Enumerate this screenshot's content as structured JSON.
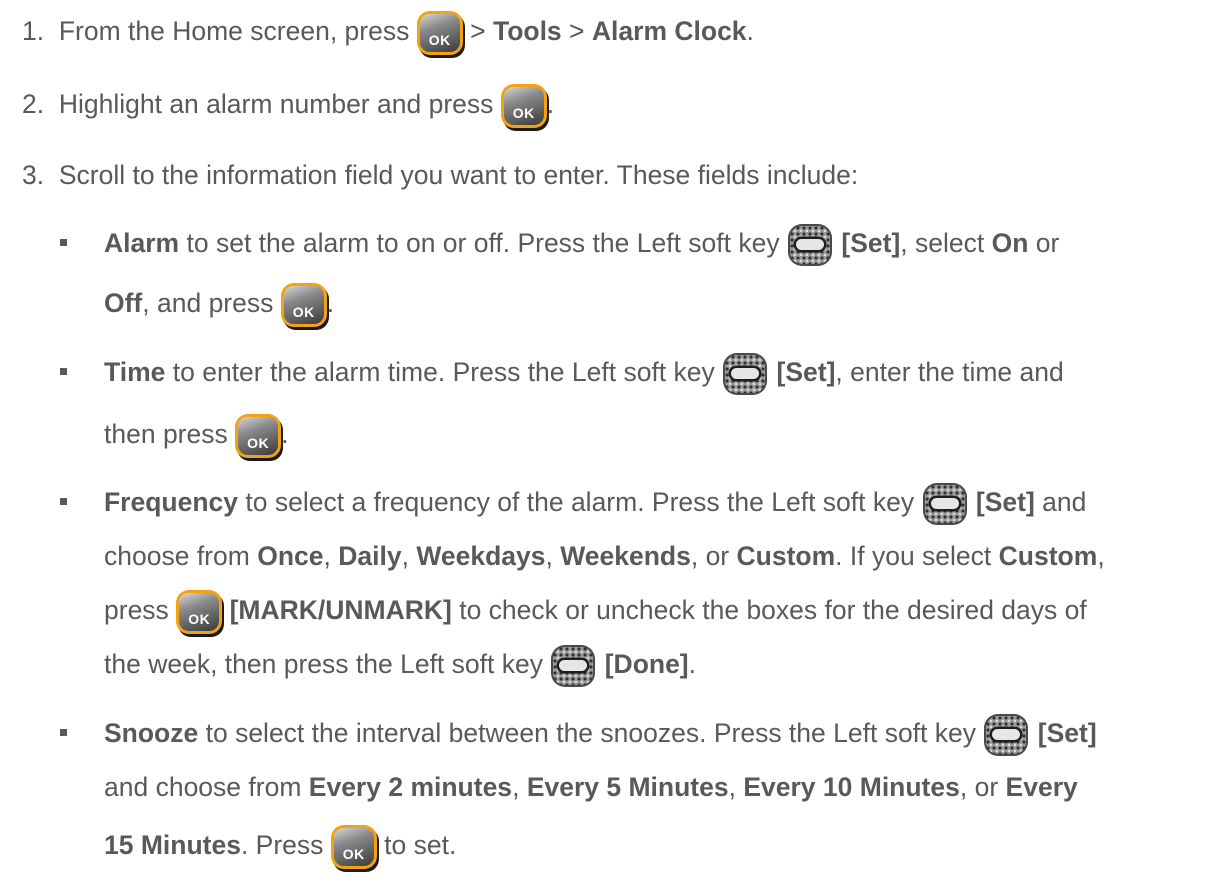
{
  "steps": [
    {
      "num": "1.",
      "a": "From the Home screen, press",
      "b": ">",
      "c": "Tools",
      "d": ">",
      "e": "Alarm Clock",
      "f": "."
    },
    {
      "num": "2.",
      "a": "Highlight an alarm number and press",
      "b": "."
    },
    {
      "num": "3.",
      "a": "Scroll to the information field you want to enter. These fields include:"
    }
  ],
  "key_ok_label": "OK",
  "alarm": {
    "term": "Alarm",
    "t1": "to set the alarm to on or off. Press the Left soft key",
    "set": "[Set]",
    "t2": ", select",
    "on": "On",
    "or": "or",
    "off": "Off",
    "t3": ", and press",
    "end": "."
  },
  "time": {
    "term": "Time",
    "t1": "to enter the alarm time. Press the Left soft key",
    "set": "[Set]",
    "t2": ", enter the time and",
    "t3": "then press",
    "end": "."
  },
  "frequency": {
    "term": "Frequency",
    "t1": "to select a frequency of the alarm. Press the Left soft key",
    "set": "[Set]",
    "and": "and",
    "choose": "choose from",
    "once": "Once",
    "comma1": ",",
    "daily": "Daily",
    "comma2": ",",
    "weekdays": "Weekdays",
    "comma3": ",",
    "weekends": "Weekends",
    "or": ", or",
    "custom": "Custom",
    "if": ". If you select",
    "custom2": "Custom",
    "comma4": ",",
    "press": "press",
    "mark": "[MARK/UNMARK]",
    "t3": "to check or uncheck the boxes for the desired days of",
    "t4": "the week, then press the Left soft key",
    "done": "[Done]",
    "end": "."
  },
  "snooze": {
    "term": "Snooze",
    "t1": "to select the interval between the snoozes. Press the Left soft key",
    "set": "[Set]",
    "and": "and choose from",
    "e2": "Every 2 minutes",
    "c1": ",",
    "e5": "Every 5 Minutes",
    "c2": ",",
    "e10": "Every 10 Minutes",
    "or": ", or",
    "every": "Every",
    "e15": "15 Minutes",
    "press": ". Press",
    "toset": "to set."
  }
}
